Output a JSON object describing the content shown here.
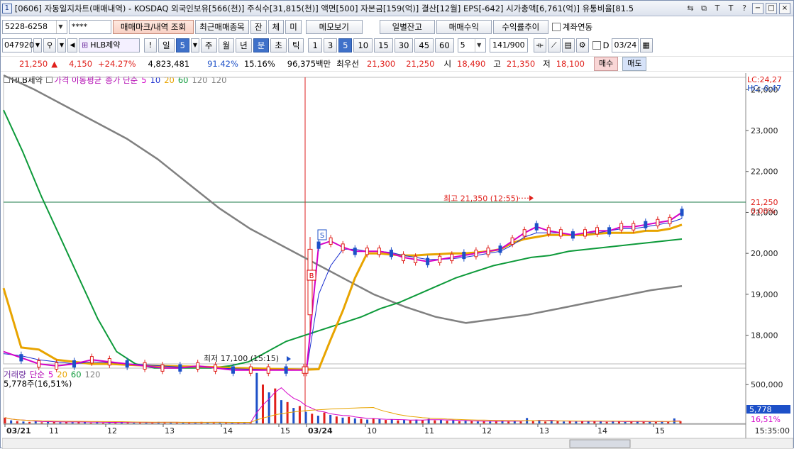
{
  "title": {
    "num": "1",
    "text": "[0606] 자동일지차트(매매내역) - KOSDAQ 외국인보유[566(천)] 주식수[31,815(천)] 액면[500] 자본금[159(억)] 결산[12월] EPS[-642] 시가총액[6,761(억)] 유통비율[81.5"
  },
  "toolbar1": {
    "account": "5228-6258",
    "password": "****",
    "btn_trades": "매매마크/내역 조회",
    "btn_recent": "최근매매종목",
    "btn_jan": "잔",
    "btn_che": "체",
    "btn_mi": "미",
    "btn_memo": "메모보기",
    "btn_daily": "일별잔고",
    "btn_profit": "매매수익",
    "btn_rate": "수익률추이",
    "chk_link": "계좌연동"
  },
  "toolbar2": {
    "code": "047920",
    "stock_name": "HLB제약",
    "period_day": "일",
    "period_sel": "5",
    "periods": [
      "주",
      "월",
      "년",
      "분",
      "초",
      "틱"
    ],
    "minutes": [
      "1",
      "3",
      "5",
      "10",
      "15",
      "30",
      "45",
      "60"
    ],
    "minute_sel": "5",
    "count_sel": "5",
    "count": "141",
    "count_total": "/900",
    "d_label": "D",
    "date": "03/24"
  },
  "quote": {
    "price": "21,250",
    "arrow": "▲",
    "change": "4,150",
    "change_pct": "+24.27%",
    "volume": "4,823,481",
    "vol_pct": "91.42%",
    "turnover": "15.16%",
    "amount": "96,375백만",
    "best_label": "최우선",
    "best_ask": "21,300",
    "best_bid": "21,250",
    "open_label": "시",
    "open": "18,490",
    "high_label": "고",
    "high": "21,350",
    "low_label": "저",
    "low": "18,100",
    "buy_label": "매수",
    "sell_label": "매도"
  },
  "colors": {
    "ma5": "#d400c8",
    "ma10": "#1b2fd0",
    "ma20": "#e8a400",
    "ma60": "#0d9a3a",
    "ma120": "#808080",
    "up": "#e0201b",
    "down": "#1d50c8"
  },
  "legend": {
    "stock": "HLB제약",
    "price_ma": "가격 이동평균",
    "close_simple": "종가 단순",
    "periods": [
      "5",
      "10",
      "20",
      "60",
      "120",
      "120"
    ],
    "volume_label": "거래량",
    "volume_simple": "단순",
    "volume_periods": [
      "5",
      "20",
      "60",
      "120"
    ],
    "volume_value": "5,778주(16,51%)"
  },
  "price_axis": {
    "lc": "LC:24,27",
    "hc": "HC:-0,47",
    "ticks": [
      "24,000",
      "23,000",
      "22,000",
      "21,000",
      "20,000",
      "19,000",
      "18,000"
    ],
    "current": "21,250",
    "current_pct": "0,00%"
  },
  "volume_axis": {
    "tick": "500,000",
    "current": "5,778",
    "current_pct": "16,51%"
  },
  "time_axis": {
    "labels": [
      "03/21",
      "11",
      "12",
      "13",
      "14",
      "15",
      "03/24",
      "10",
      "11",
      "12",
      "13",
      "14",
      "15"
    ],
    "clock": "15:35:00"
  },
  "annotations": {
    "high": "최고 21,350 (12:55)",
    "low": "최저 17,100 (15:15)",
    "buy_mark": "B",
    "sell_mark": "S"
  },
  "chart_data": {
    "type": "line",
    "title": "",
    "xlabel": "",
    "ylabel": "",
    "ylim": [
      17300,
      24300
    ],
    "high": 21350,
    "low": 17100,
    "current": 21250,
    "series": [
      {
        "name": "5",
        "values": [
          17600,
          17450,
          17300,
          17250,
          17300,
          17400,
          17350,
          17300,
          17250,
          17200,
          17200,
          17250,
          17200,
          17150,
          17150,
          17150,
          17150,
          17150,
          20200,
          20300,
          20150,
          20050,
          20050,
          20050,
          20000,
          19900,
          19850,
          19800,
          19850,
          19900,
          19950,
          20000,
          20050,
          20100,
          20300,
          20500,
          20650,
          20550,
          20500,
          20450,
          20500,
          20550,
          20550,
          20650,
          20650,
          20700,
          20750,
          20800,
          21000
        ]
      },
      {
        "name": "10",
        "values": [
          17550,
          17500,
          17400,
          17350,
          17300,
          17350,
          17330,
          17300,
          17280,
          17250,
          17220,
          17230,
          17200,
          17180,
          17170,
          17160,
          17160,
          17150,
          19000,
          19700,
          20100,
          20100,
          20050,
          20050,
          20020,
          19950,
          19900,
          19850,
          19850,
          19870,
          19900,
          19950,
          20000,
          20050,
          20200,
          20400,
          20500,
          20500,
          20500,
          20450,
          20500,
          20500,
          20550,
          20600,
          20600,
          20650,
          20700,
          20750,
          20850
        ]
      },
      {
        "name": "20",
        "values": [
          19150,
          17700,
          17650,
          17400,
          17350,
          17300,
          17300,
          17280,
          17260,
          17250,
          17240,
          17230,
          17220,
          17200,
          17190,
          17180,
          17170,
          17160,
          17170,
          17900,
          18600,
          19400,
          20000,
          20000,
          19970,
          19950,
          19950,
          19970,
          19980,
          20000,
          20000,
          20020,
          20050,
          20100,
          20250,
          20350,
          20400,
          20450,
          20450,
          20450,
          20450,
          20480,
          20500,
          20500,
          20500,
          20550,
          20550,
          20600,
          20700
        ]
      },
      {
        "name": "60",
        "values": [
          23500,
          22500,
          21400,
          20400,
          19400,
          18400,
          17600,
          17300,
          17200,
          17200,
          17200,
          17200,
          17250,
          17350,
          17600,
          17850,
          18000,
          18150,
          18300,
          18450,
          18650,
          18800,
          19000,
          19200,
          19400,
          19550,
          19700,
          19800,
          19900,
          19950,
          20050,
          20100,
          20150,
          20200,
          20250,
          20300,
          20350
        ]
      },
      {
        "name": "120",
        "values": [
          24350,
          24000,
          23600,
          23200,
          22800,
          22300,
          21700,
          21100,
          20600,
          20200,
          19800,
          19400,
          19000,
          18700,
          18450,
          18300,
          18400,
          18500,
          18650,
          18800,
          18950,
          19100,
          19200
        ]
      }
    ],
    "volume": [
      15,
      8,
      6,
      5,
      4,
      6,
      3,
      5,
      4,
      3,
      4,
      3,
      5,
      3,
      2,
      4,
      2,
      3,
      3,
      4,
      3,
      2,
      3,
      2,
      3,
      4,
      3,
      3,
      2,
      2,
      3,
      3,
      4,
      2,
      3,
      3,
      2,
      2,
      3,
      2,
      3,
      130,
      100,
      80,
      90,
      60,
      55,
      40,
      45,
      30,
      25,
      20,
      28,
      22,
      18,
      15,
      17,
      13,
      12,
      10,
      12,
      11,
      9,
      10,
      8,
      9,
      8,
      10,
      9,
      12,
      8,
      9,
      7,
      8,
      6,
      7,
      6,
      5,
      6,
      5,
      6,
      7,
      5,
      6,
      5,
      14,
      6,
      9,
      5,
      7,
      6,
      5,
      6,
      5,
      5,
      7,
      6,
      5,
      4,
      6,
      5,
      4,
      5,
      6,
      4,
      5,
      4,
      6,
      4,
      13,
      6
    ]
  }
}
